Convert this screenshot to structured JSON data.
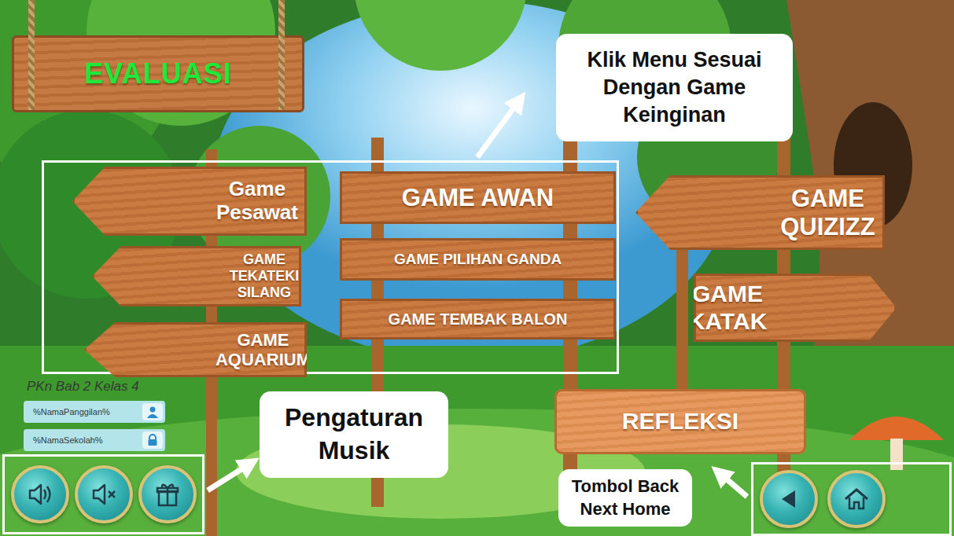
{
  "title": "EVALUASI",
  "menu": [
    {
      "label": "Game Pesawat",
      "kind": "arrow-left"
    },
    {
      "label": "GAME TEKATEKI SILANG",
      "kind": "arrow-left"
    },
    {
      "label": "GAME AQUARIUM",
      "kind": "arrow-left"
    },
    {
      "label": "GAME AWAN",
      "kind": "board"
    },
    {
      "label": "GAME PILIHAN GANDA",
      "kind": "board"
    },
    {
      "label": "GAME TEMBAK BALON",
      "kind": "board"
    },
    {
      "label": "GAME QUIZIZZ",
      "kind": "arrow-left"
    },
    {
      "label": "GAME KATAK",
      "kind": "arrow-right"
    }
  ],
  "refleksi": {
    "label": "REFLEKSI"
  },
  "subject": "PKn Bab 2 Kelas 4",
  "user_fields": [
    {
      "value": "%NamaPanggilan%",
      "kind": "user"
    },
    {
      "value": "%NamaSekolah%",
      "kind": "lock"
    }
  ],
  "music_buttons": [
    {
      "kind": "sound-on"
    },
    {
      "kind": "mute"
    },
    {
      "kind": "gift"
    }
  ],
  "nav_buttons": [
    {
      "kind": "back"
    },
    {
      "kind": "home"
    }
  ],
  "annotations": {
    "menu_hint": "Klik Menu Sesuai Dengan Game Keinginan",
    "music_hint": "Pengaturan Musik",
    "nav_hint": "Tombol Back Next Home"
  }
}
